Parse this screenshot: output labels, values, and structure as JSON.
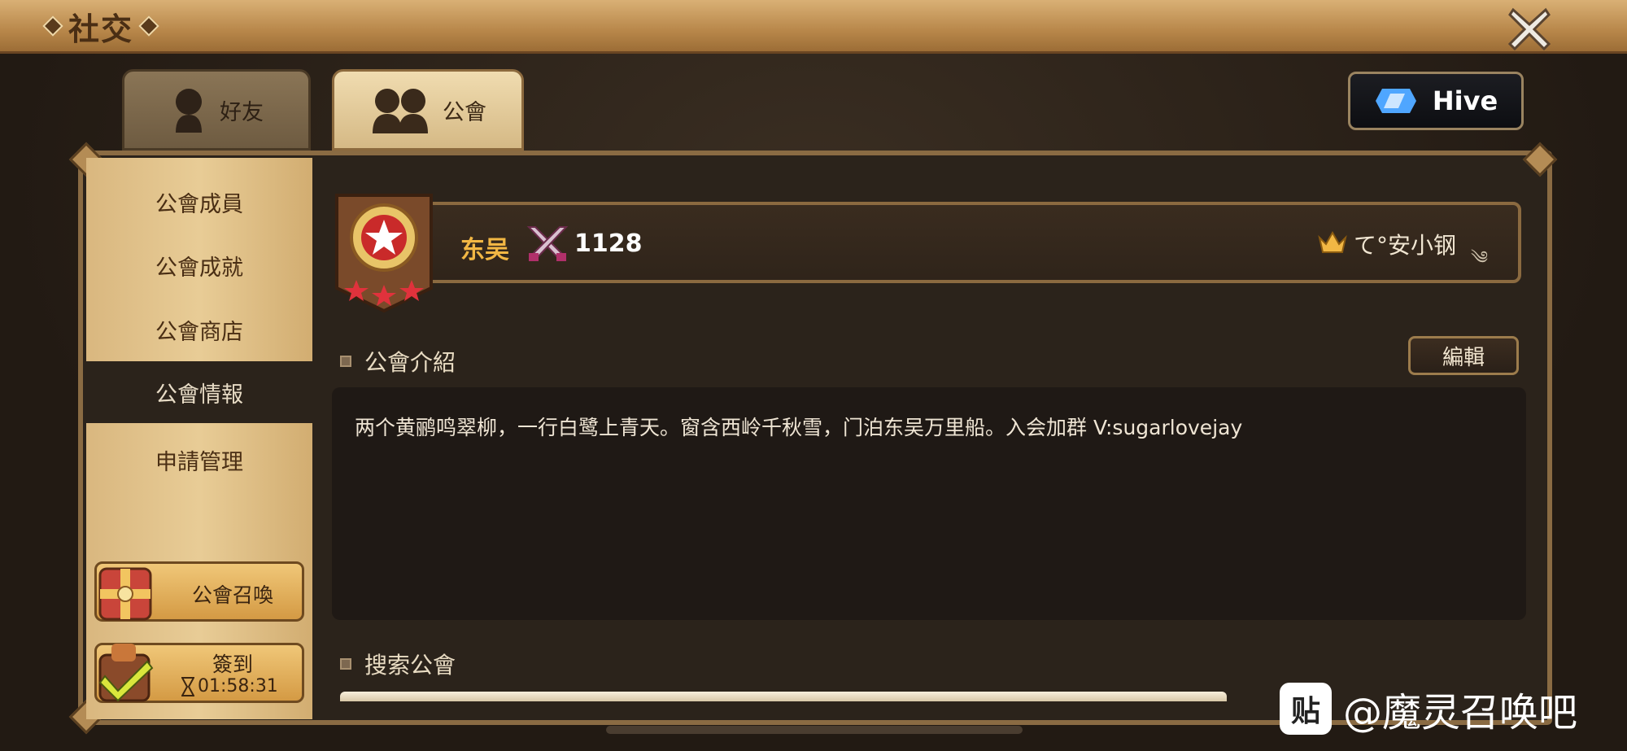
{
  "window": {
    "title": "社交",
    "close_label": "✕"
  },
  "tabs": [
    {
      "label": "好友",
      "icon": "person-icon",
      "active": false
    },
    {
      "label": "公會",
      "icon": "group-icon",
      "active": true
    }
  ],
  "hive_button": {
    "label": "Hive",
    "icon": "hive-logo-icon"
  },
  "sidebar": {
    "items": [
      {
        "label": "公會成員",
        "active": false
      },
      {
        "label": "公會成就",
        "active": false
      },
      {
        "label": "公會商店",
        "active": false
      },
      {
        "label": "公會情報",
        "active": true
      },
      {
        "label": "申請管理",
        "active": false
      }
    ],
    "summon_button": {
      "label": "公會召喚",
      "icon": "gift-box-icon"
    },
    "checkin_button": {
      "label": "簽到",
      "timer": "01:58:31",
      "icon": "checkmark-chest-icon"
    }
  },
  "guild": {
    "name": "东吴",
    "score": "1128",
    "leader": "て°安小钢",
    "leader_mark": "༄",
    "rank_stars": 3
  },
  "intro": {
    "heading": "公會介紹",
    "edit_label": "編輯",
    "text": "两个黄鹂鸣翠柳，一行白鹭上青天。窗含西岭千秋雪，门泊东吴万里船。入会加群 V:sugarlovejay"
  },
  "search": {
    "heading": "搜索公會"
  },
  "watermark": {
    "badge": "贴",
    "text": "@魔灵召唤吧"
  },
  "colors": {
    "accent_gold": "#f2b744",
    "frame": "#8a6b43",
    "panel": "#2b231b"
  }
}
